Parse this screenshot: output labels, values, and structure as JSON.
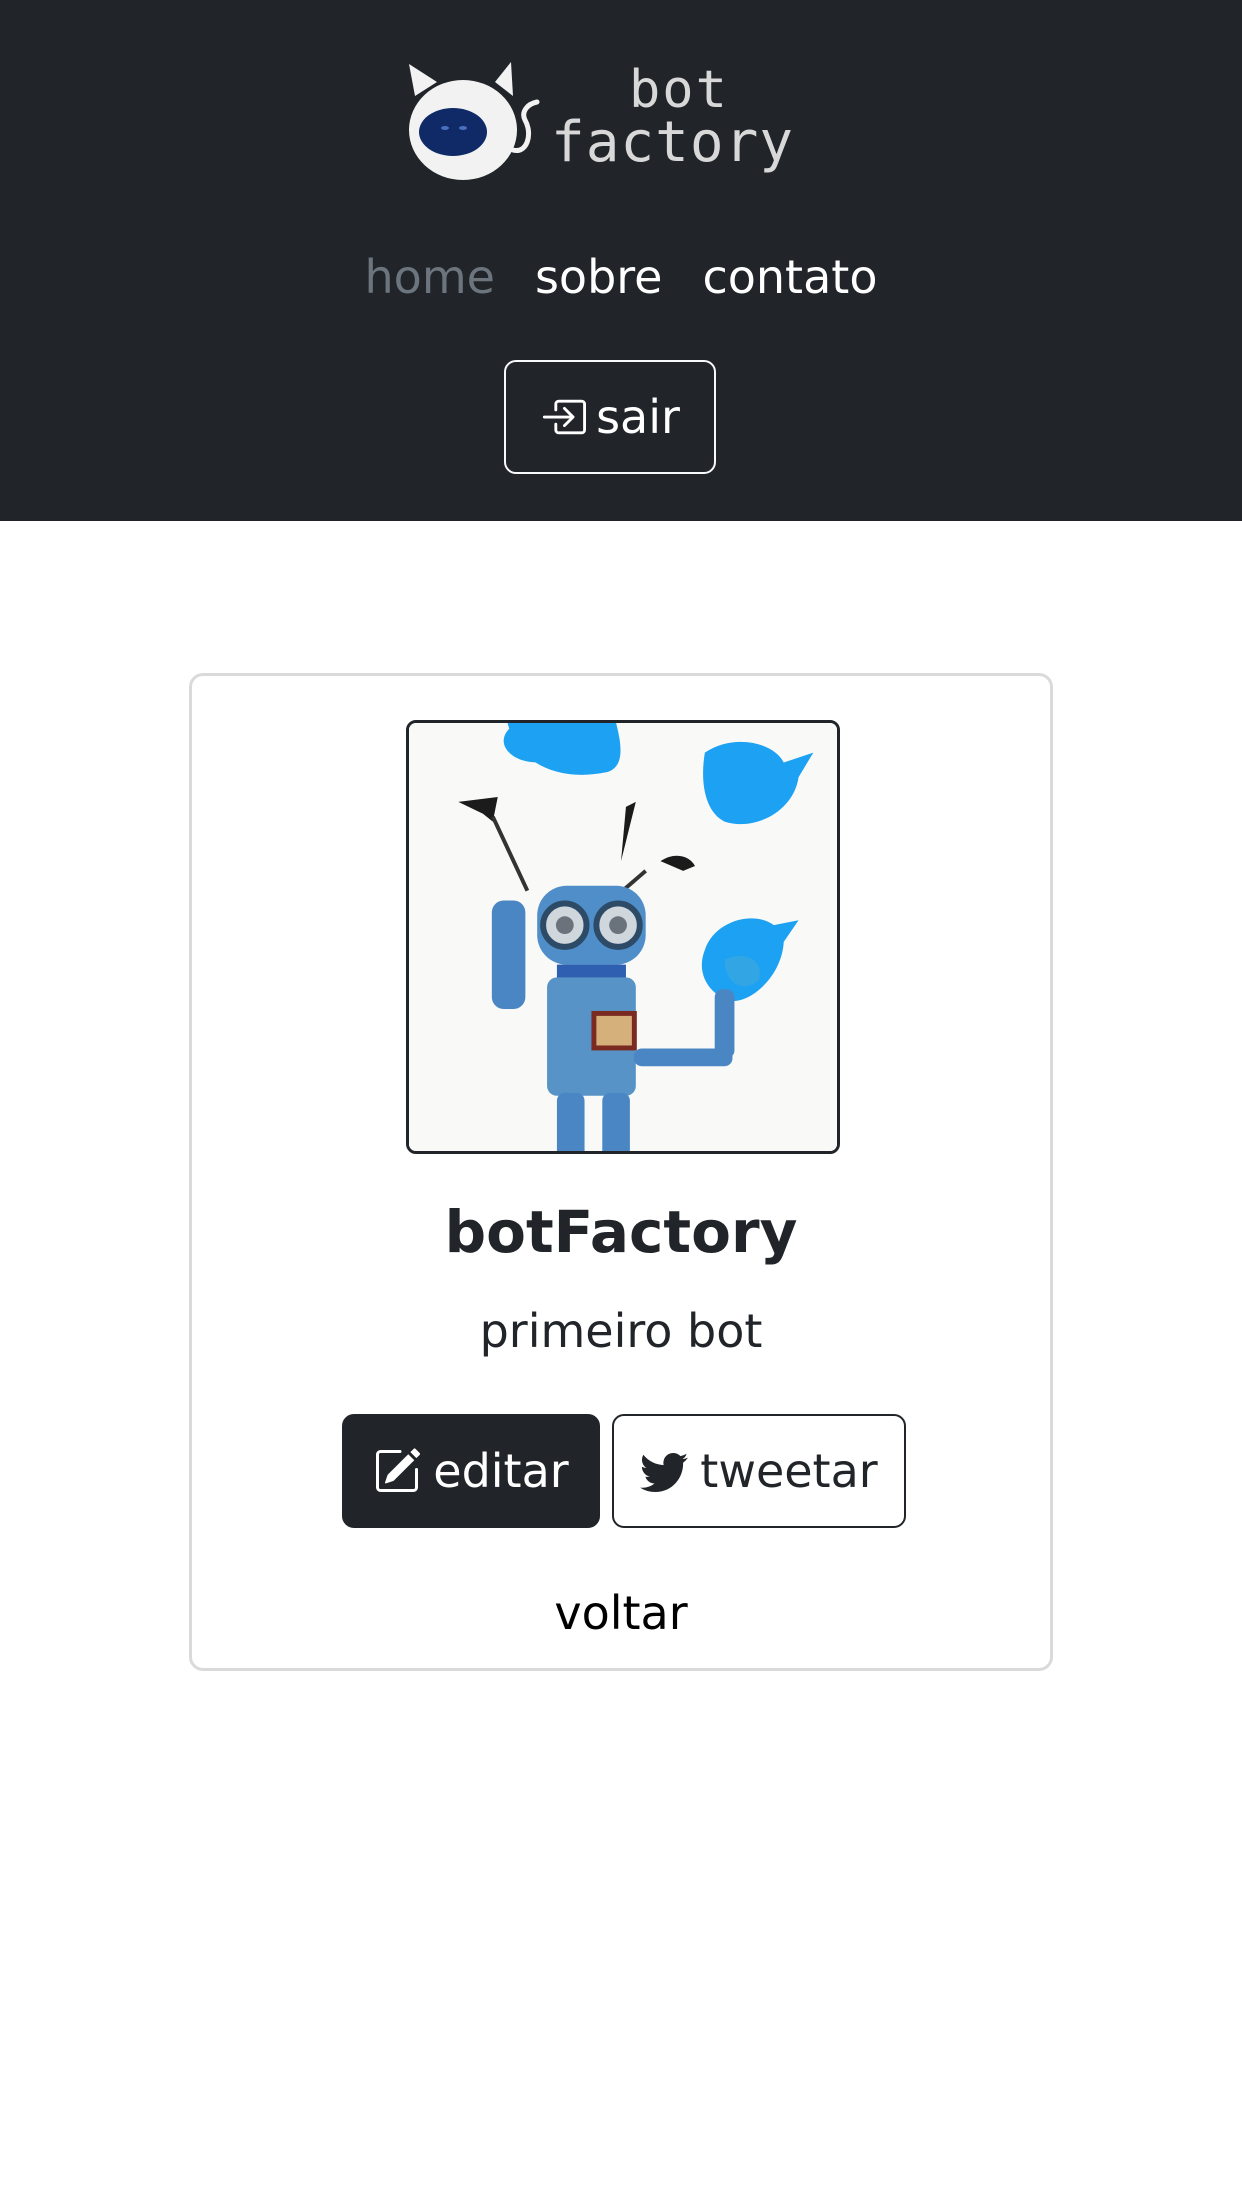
{
  "header": {
    "logo": {
      "line1": "bot",
      "line2": "factory"
    },
    "nav": {
      "home": "home",
      "sobre": "sobre",
      "contato": "contato"
    },
    "logout_label": "sair"
  },
  "bot": {
    "name": "botFactory",
    "description": "primeiro bot"
  },
  "actions": {
    "edit_label": "editar",
    "tweet_label": "tweetar",
    "back_label": "voltar"
  },
  "colors": {
    "header_bg": "#212529",
    "nav_active": "#6c757d",
    "primary_button": "#212529",
    "twitter_blue": "#1da1f2"
  },
  "icons": {
    "logout": "box-arrow-in-right-icon",
    "edit": "pencil-square-icon",
    "tweet": "twitter-bird-icon",
    "logo": "cat-robot-logo"
  }
}
